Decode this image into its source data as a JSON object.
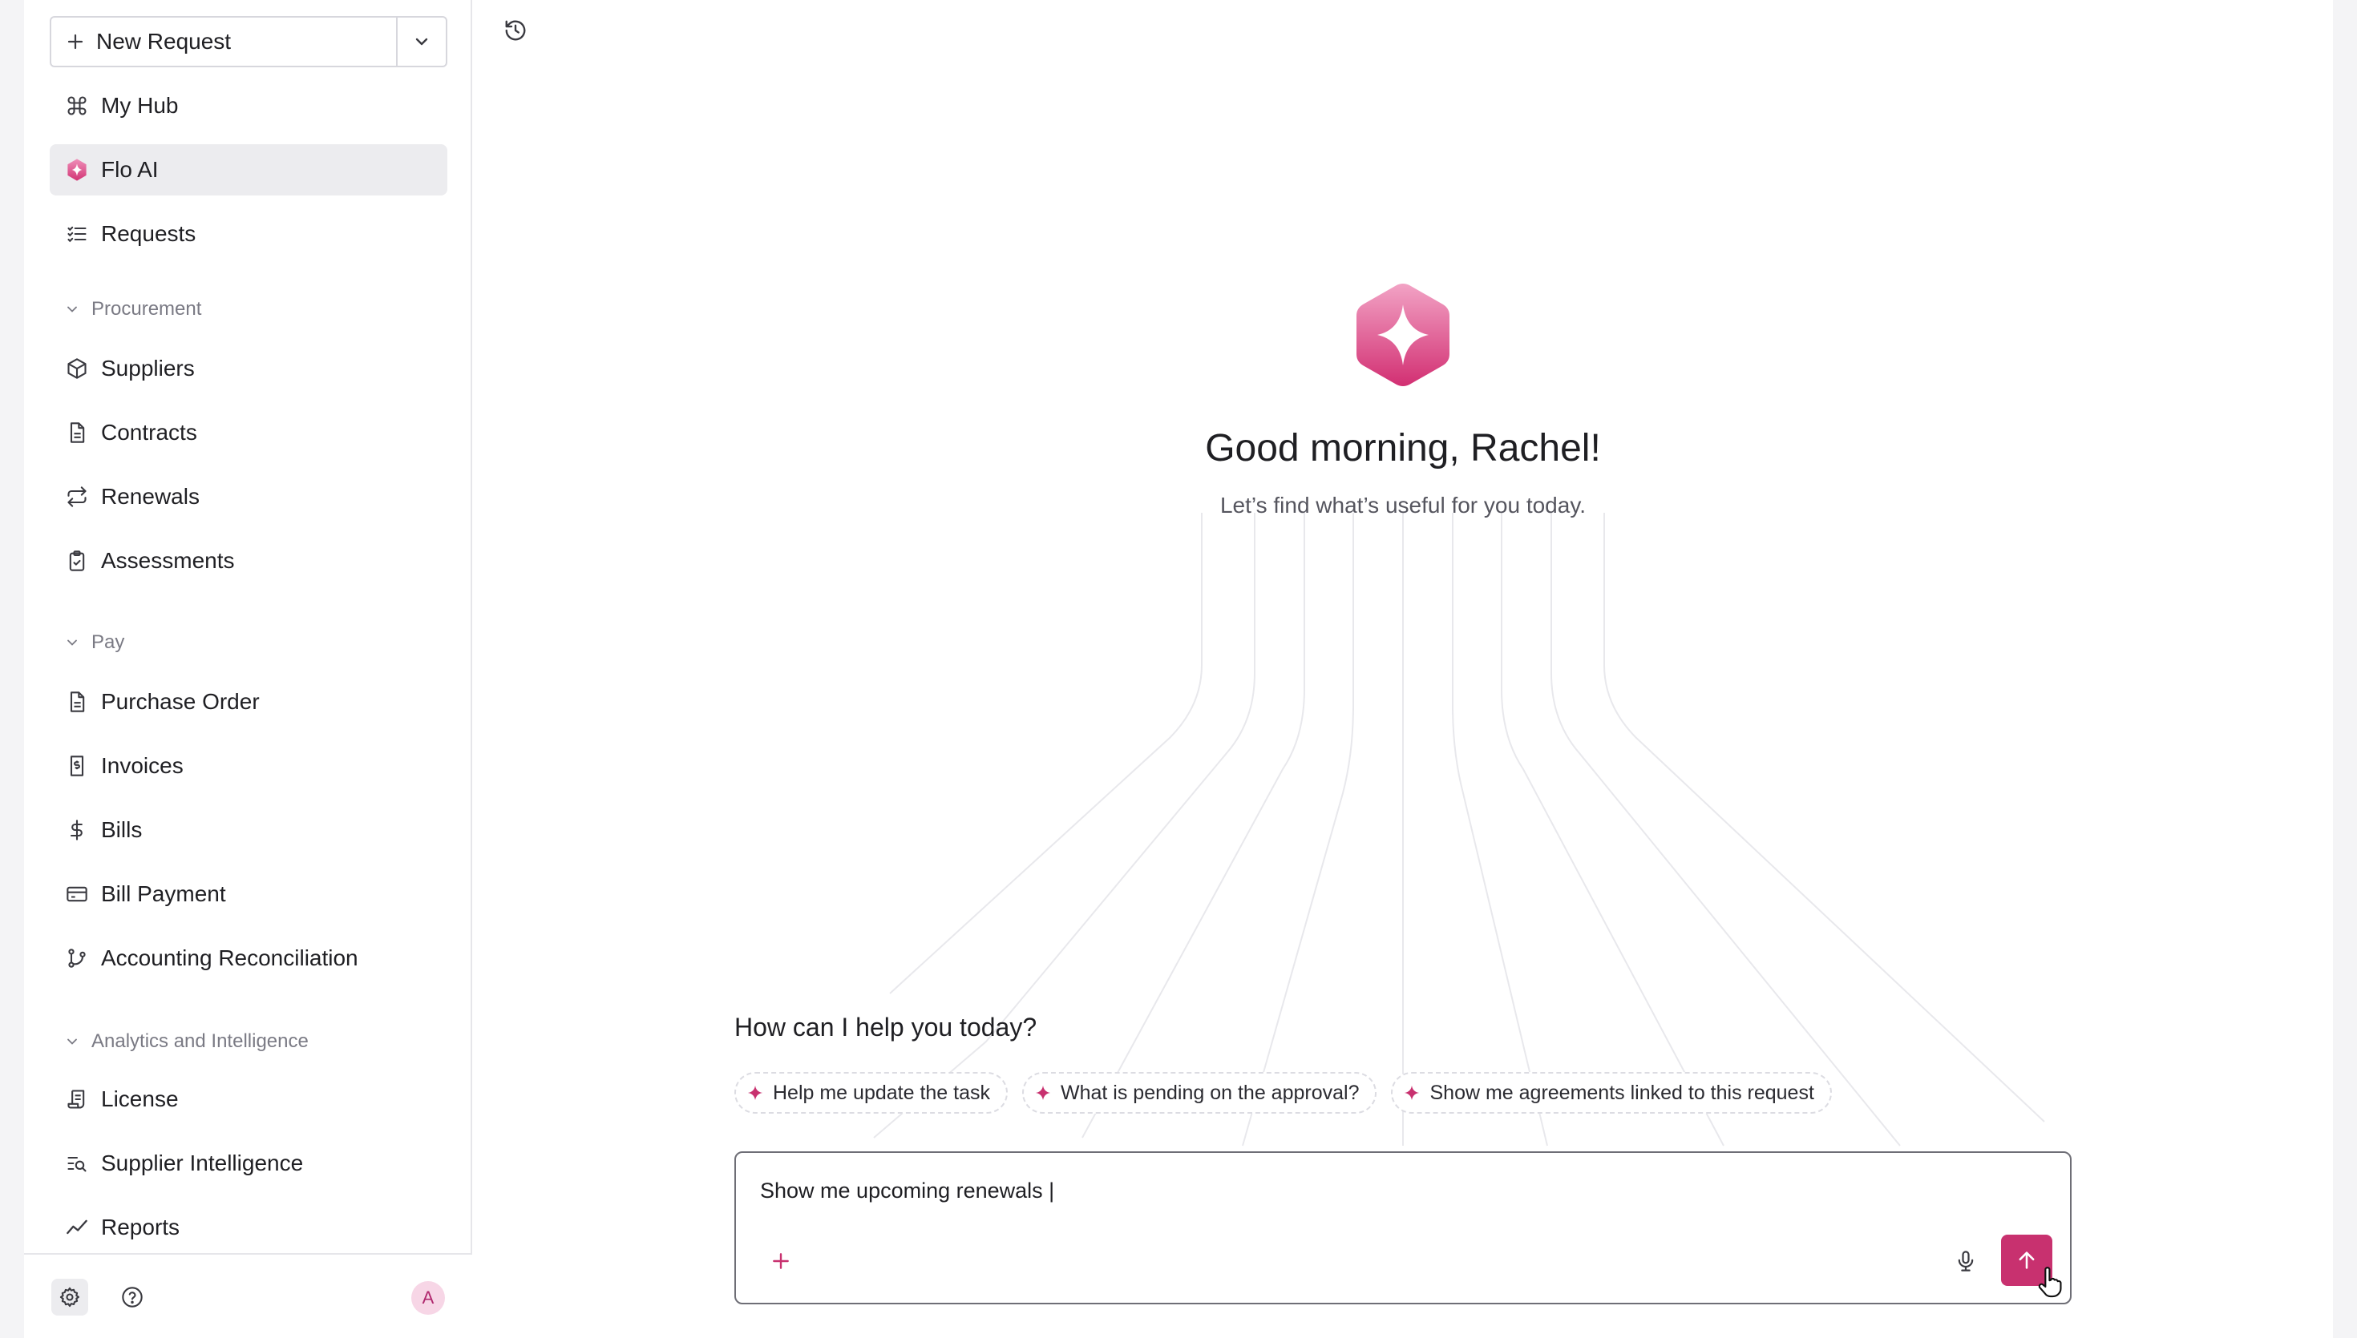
{
  "sidebar": {
    "new_request": "New Request",
    "items": [
      {
        "label": "My Hub",
        "icon": "hub-icon"
      },
      {
        "label": "Flo AI",
        "icon": "flo-ai-logo-icon",
        "active": true
      },
      {
        "label": "Requests",
        "icon": "checklist-icon"
      }
    ],
    "sections": [
      {
        "title": "Procurement",
        "items": [
          {
            "label": "Suppliers",
            "icon": "box-icon"
          },
          {
            "label": "Contracts",
            "icon": "document-icon"
          },
          {
            "label": "Renewals",
            "icon": "repeat-icon"
          },
          {
            "label": "Assessments",
            "icon": "clipboard-check-icon"
          }
        ]
      },
      {
        "title": "Pay",
        "items": [
          {
            "label": "Purchase Order",
            "icon": "document-icon"
          },
          {
            "label": "Invoices",
            "icon": "receipt-icon"
          },
          {
            "label": "Bills",
            "icon": "dollar-icon"
          },
          {
            "label": "Bill Payment",
            "icon": "credit-card-icon"
          },
          {
            "label": "Accounting Reconciliation",
            "icon": "git-branch-icon"
          }
        ]
      },
      {
        "title": "Analytics and Intelligence",
        "items": [
          {
            "label": "License",
            "icon": "license-icon"
          },
          {
            "label": "Supplier Intelligence",
            "icon": "search-list-icon"
          },
          {
            "label": "Reports",
            "icon": "trend-line-icon"
          }
        ]
      }
    ],
    "avatar_initial": "A"
  },
  "main": {
    "greeting": "Good morning, Rachel!",
    "subtitle": "Let’s find what’s useful for you today.",
    "help_title": "How can I help you today?",
    "suggestions": [
      "Help me update the task",
      "What is pending on the approval?",
      "Show me agreements linked to this request"
    ],
    "input_value": "Show me upcoming renewals |"
  },
  "colors": {
    "accent": "#c8316f",
    "active_bg": "#ececef",
    "sidebar_border": "#e6e6ea"
  }
}
